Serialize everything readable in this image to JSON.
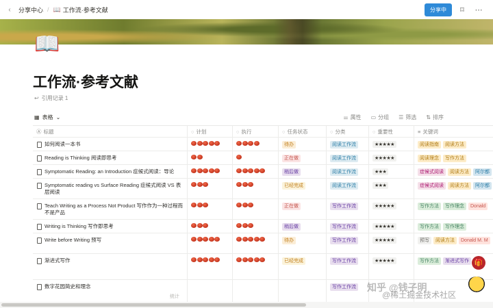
{
  "topbar": {
    "breadcrumb_parent": "分享中心",
    "breadcrumb_current_icon": "📖",
    "breadcrumb_current": "工作流·参考文献",
    "share_label": "分享中",
    "bookmark_icon": "bookmark-icon",
    "more_icon": "more-icon"
  },
  "page": {
    "icon": "📖",
    "title": "工作流·参考文献",
    "backlinks": "引用记录 1"
  },
  "view": {
    "tab_label": "表格",
    "actions": [
      "属性",
      "分组",
      "筛选",
      "排序"
    ]
  },
  "columns": [
    "标题",
    "计划",
    "执行",
    "任务状态",
    "分类",
    "重要性",
    "关键词"
  ],
  "rows": [
    {
      "title": "如何阅读一本书",
      "plan": 5,
      "exec": 4,
      "status": "待办",
      "status_style": "todo",
      "category": "阅读工作流",
      "stars": "★★★★★",
      "keywords": [
        [
          "阅读指南",
          "yellow"
        ],
        [
          "阅读方法",
          "yellow"
        ]
      ]
    },
    {
      "title": "Reading is Thinking 阅读即思考",
      "plan": 2,
      "exec": 1,
      "status": "正在做",
      "status_style": "doing",
      "category": "阅读工作流",
      "stars": "★★★★★",
      "keywords": [
        [
          "阅读理念",
          "yellow"
        ],
        [
          "写作方法",
          "yellow"
        ]
      ]
    },
    {
      "title": "Symptomatic Reading: an Introduction  症候式阅读：导论",
      "plan": 5,
      "exec": 5,
      "status": "稍后做",
      "status_style": "later",
      "category": "阅读工作流",
      "stars": "★★★",
      "keywords": [
        [
          "症候式阅读",
          "pink"
        ],
        [
          "阅读方法",
          "yellow"
        ],
        [
          "阿尔都",
          "blue"
        ]
      ]
    },
    {
      "title": "Symptomatic reading vs Surface Reading 症候式阅读 VS 表层阅读",
      "plan": 3,
      "exec": 3,
      "status": "已经完成",
      "status_style": "done",
      "category": "阅读工作流",
      "stars": "★★★",
      "keywords": [
        [
          "症候式阅读",
          "pink"
        ],
        [
          "阅读方法",
          "yellow"
        ],
        [
          "阿尔都",
          "blue"
        ]
      ]
    },
    {
      "title": "Teach Writing as a Process Not Product  写作作为一种过程而不是产品",
      "plan": 3,
      "exec": 3,
      "status": "正在做",
      "status_style": "doing",
      "category": "写作工作流",
      "stars": "★★★★★",
      "keywords": [
        [
          "写作方法",
          "green"
        ],
        [
          "写作理念",
          "green"
        ],
        [
          "Donald",
          "red"
        ]
      ]
    },
    {
      "title": "Writing is Thinking 写作即思考",
      "plan": 3,
      "exec": 3,
      "status": "稍后做",
      "status_style": "later",
      "category": "写作工作流",
      "stars": "★★★★★",
      "keywords": [
        [
          "写作方法",
          "green"
        ],
        [
          "写作理念",
          "green"
        ]
      ]
    },
    {
      "title": "Write before Writing  预写",
      "plan": 5,
      "exec": 5,
      "status": "待办",
      "status_style": "todo",
      "category": "写作工作流",
      "stars": "★★★★★",
      "keywords": [
        [
          "预写",
          "gray"
        ],
        [
          "阅读方法",
          "yellow"
        ],
        [
          "Donald M. M",
          "red"
        ]
      ]
    },
    {
      "title": "渐进式写作",
      "plan": 5,
      "exec": 5,
      "status": "已经完成",
      "status_style": "done",
      "category": "写作工作流",
      "stars": "★★★★★",
      "keywords": [
        [
          "写作方法",
          "green"
        ],
        [
          "渐进式写作",
          "purple"
        ]
      ]
    },
    {
      "title": "数字花园简史和理念",
      "plan": 0,
      "exec": 0,
      "status": "",
      "status_style": "",
      "category": "写作工作流",
      "stars": "",
      "keywords": []
    }
  ],
  "footer": {
    "calc_label": "统计"
  },
  "watermark": {
    "line1": "知乎 @钱子明",
    "line2": "@稀土掘金技术社区"
  }
}
